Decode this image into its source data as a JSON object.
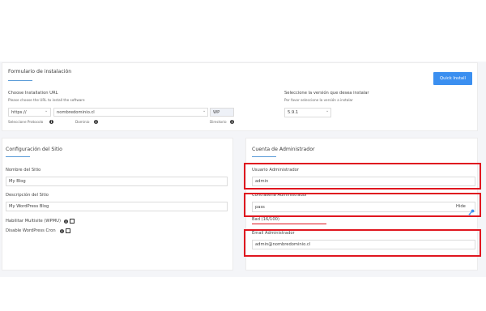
{
  "install_form": {
    "title": "Formulario de instalación",
    "quick_install_label": "Quick Install",
    "choose_url_label": "Choose Installation URL",
    "choose_url_help": "Please choose the URL to install the software",
    "protocol_value": "https://",
    "domain_value": "nombredominio.cl",
    "directory_value": "WP",
    "protocol_caption": "Seleccione Protocolo",
    "domain_caption": "Dominio",
    "directory_caption": "Directorio",
    "version_label": "Seleccione la versión que desea instalar",
    "version_help": "Por favor seleccione la versión a instalar",
    "version_value": "5.9.1"
  },
  "site_config": {
    "title": "Configuración del Sitio",
    "site_name_label": "Nombre del Sitio",
    "site_name_value": "My Blog",
    "site_desc_label": "Descripción del Sitio",
    "site_desc_value": "My WordPress Blog",
    "multisite_label": "Habilitar Multisite (WPMU)",
    "cron_label": "Disable WordPress Cron"
  },
  "admin_account": {
    "title": "Cuenta de Administrador",
    "username_label": "Usuario Administrador",
    "username_value": "admin",
    "password_label": "Contraseña Administrador",
    "password_value": "pass",
    "hide_label": "Hide",
    "strength_text": "Bad (16/100)",
    "email_label": "Email Administrador",
    "email_value": "admin@nombredominio.cl"
  },
  "colors": {
    "accent": "#3b8ff0",
    "highlight": "#e0161f"
  },
  "icons": [
    "info-icon",
    "key-icon",
    "chevron-down-icon"
  ]
}
